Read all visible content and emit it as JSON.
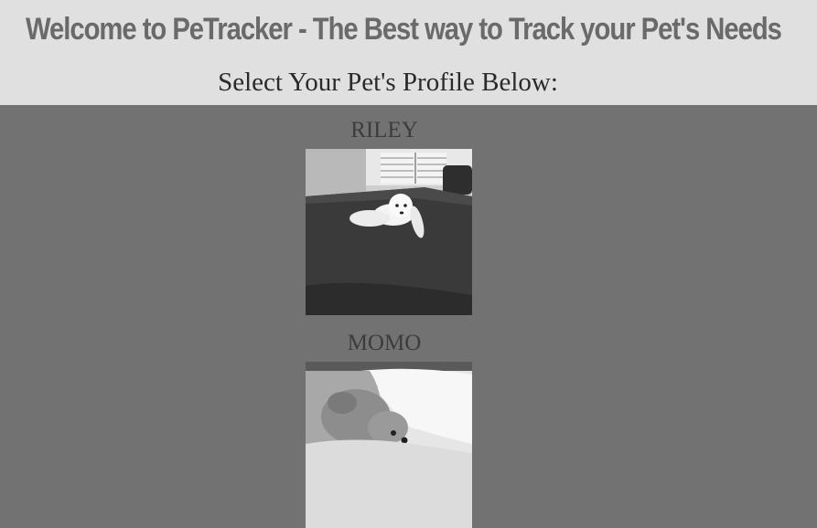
{
  "header": {
    "title": "Welcome to PeTracker - The Best way to Track your Pet's Needs",
    "subtitle": "Select Your Pet's Profile Below:"
  },
  "pets": [
    {
      "name": "RILEY",
      "photo_icon": "dog-on-bed-photo"
    },
    {
      "name": "MOMO",
      "photo_icon": "dog-on-pillow-photo"
    }
  ],
  "colors": {
    "header_bg": "#e0e0e0",
    "page_bg": "#727272",
    "title_text": "#6a6a6a"
  }
}
